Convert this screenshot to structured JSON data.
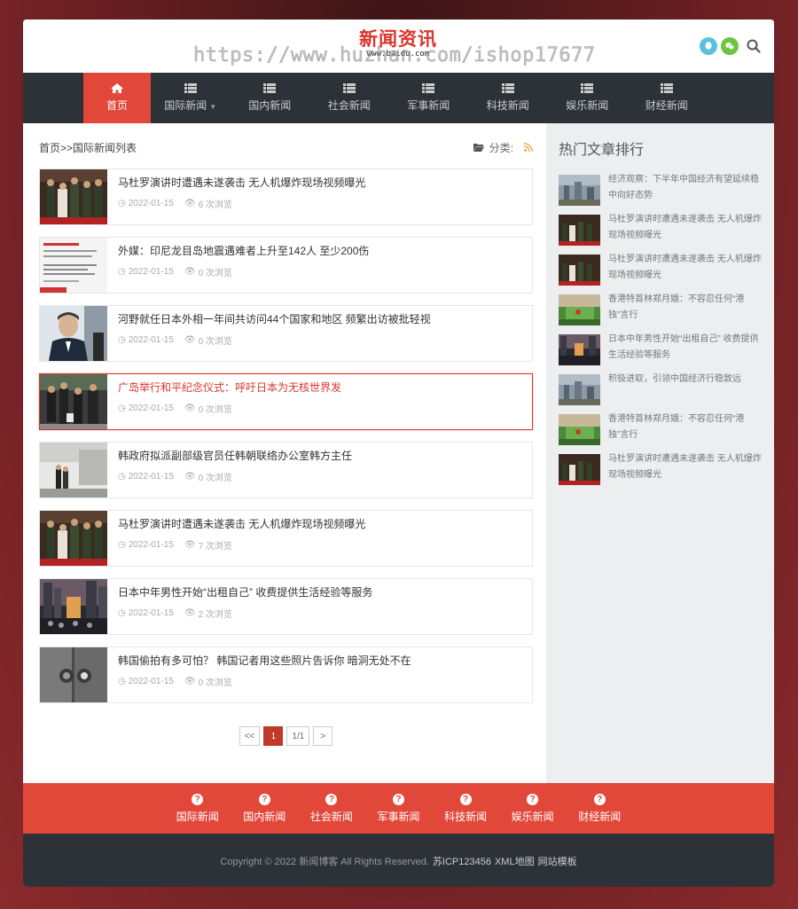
{
  "header": {
    "logo_title": "新闻资讯",
    "logo_sub": "www.baidu.com",
    "watermark": "https://www.huzhan.com/ishop17677"
  },
  "nav": {
    "items": [
      {
        "label": "首页",
        "icon": "home-icon"
      },
      {
        "label": "国际新闻",
        "icon": "list-icon",
        "dropdown": true
      },
      {
        "label": "国内新闻",
        "icon": "list-icon"
      },
      {
        "label": "社会新闻",
        "icon": "list-icon"
      },
      {
        "label": "军事新闻",
        "icon": "list-icon"
      },
      {
        "label": "科技新闻",
        "icon": "list-icon"
      },
      {
        "label": "娱乐新闻",
        "icon": "list-icon"
      },
      {
        "label": "财经新闻",
        "icon": "list-icon"
      }
    ]
  },
  "breadcrumb": "首页>>国际新闻列表",
  "category_label": "分类:",
  "articles": [
    {
      "title": "马杜罗演讲时遭遇未遂袭击 无人机爆炸现场视频曝光",
      "date": "2022-01-15",
      "views": "6 次浏览"
    },
    {
      "title": "外媒：印尼龙目岛地震遇难者上升至142人 至少200伤",
      "date": "2022-01-15",
      "views": "0 次浏览"
    },
    {
      "title": "河野就任日本外相一年间共访问44个国家和地区 频繁出访被批轻视",
      "date": "2022-01-15",
      "views": "0 次浏览"
    },
    {
      "title": "广岛举行和平纪念仪式：呼吁日本为无核世界发",
      "date": "2022-01-15",
      "views": "0 次浏览"
    },
    {
      "title": "韩政府拟派副部级官员任韩朝联络办公室韩方主任",
      "date": "2022-01-15",
      "views": "0 次浏览"
    },
    {
      "title": "马杜罗演讲时遭遇未遂袭击 无人机爆炸现场视频曝光",
      "date": "2022-01-15",
      "views": "7 次浏览"
    },
    {
      "title": "日本中年男性开始“出租自己” 收费提供生活经验等服务",
      "date": "2022-01-15",
      "views": "2 次浏览"
    },
    {
      "title": "韩国偷拍有多可怕？ 韩国记者用这些照片告诉你 暗洞无处不在",
      "date": "2022-01-15",
      "views": "0 次浏览"
    }
  ],
  "pager": {
    "prev": "<<",
    "current": "1",
    "total": "1/1",
    "next": ">"
  },
  "sidebar": {
    "title": "热门文章排行",
    "items": [
      "经济观察：下半年中国经济有望延续稳中向好态势",
      "马杜罗演讲时遭遇未遂袭击 无人机爆炸现场视频曝光",
      "马杜罗演讲时遭遇未遂袭击 无人机爆炸现场视频曝光",
      "香港特首林郑月娥：不容忍任何“港独”言行",
      "日本中年男性开始“出租自己” 收费提供生活经验等服务",
      "积极进取，引领中国经济行稳致远",
      "香港特首林郑月娥：不容忍任何“港独”言行",
      "马杜罗演讲时遭遇未遂袭击 无人机爆炸现场视频曝光"
    ]
  },
  "footer_nav": [
    "国际新闻",
    "国内新闻",
    "社会新闻",
    "军事新闻",
    "科技新闻",
    "娱乐新闻",
    "财经新闻"
  ],
  "footer": {
    "copyright": "Copyright © 2022 新闻博客 All Rights Reserved.",
    "icp": "苏ICP123456",
    "sitemap": "XML地图",
    "template": "网站模板"
  },
  "colors": {
    "accent": "#e2483a",
    "dark": "#2d3238",
    "highlight": "#d8352c"
  }
}
